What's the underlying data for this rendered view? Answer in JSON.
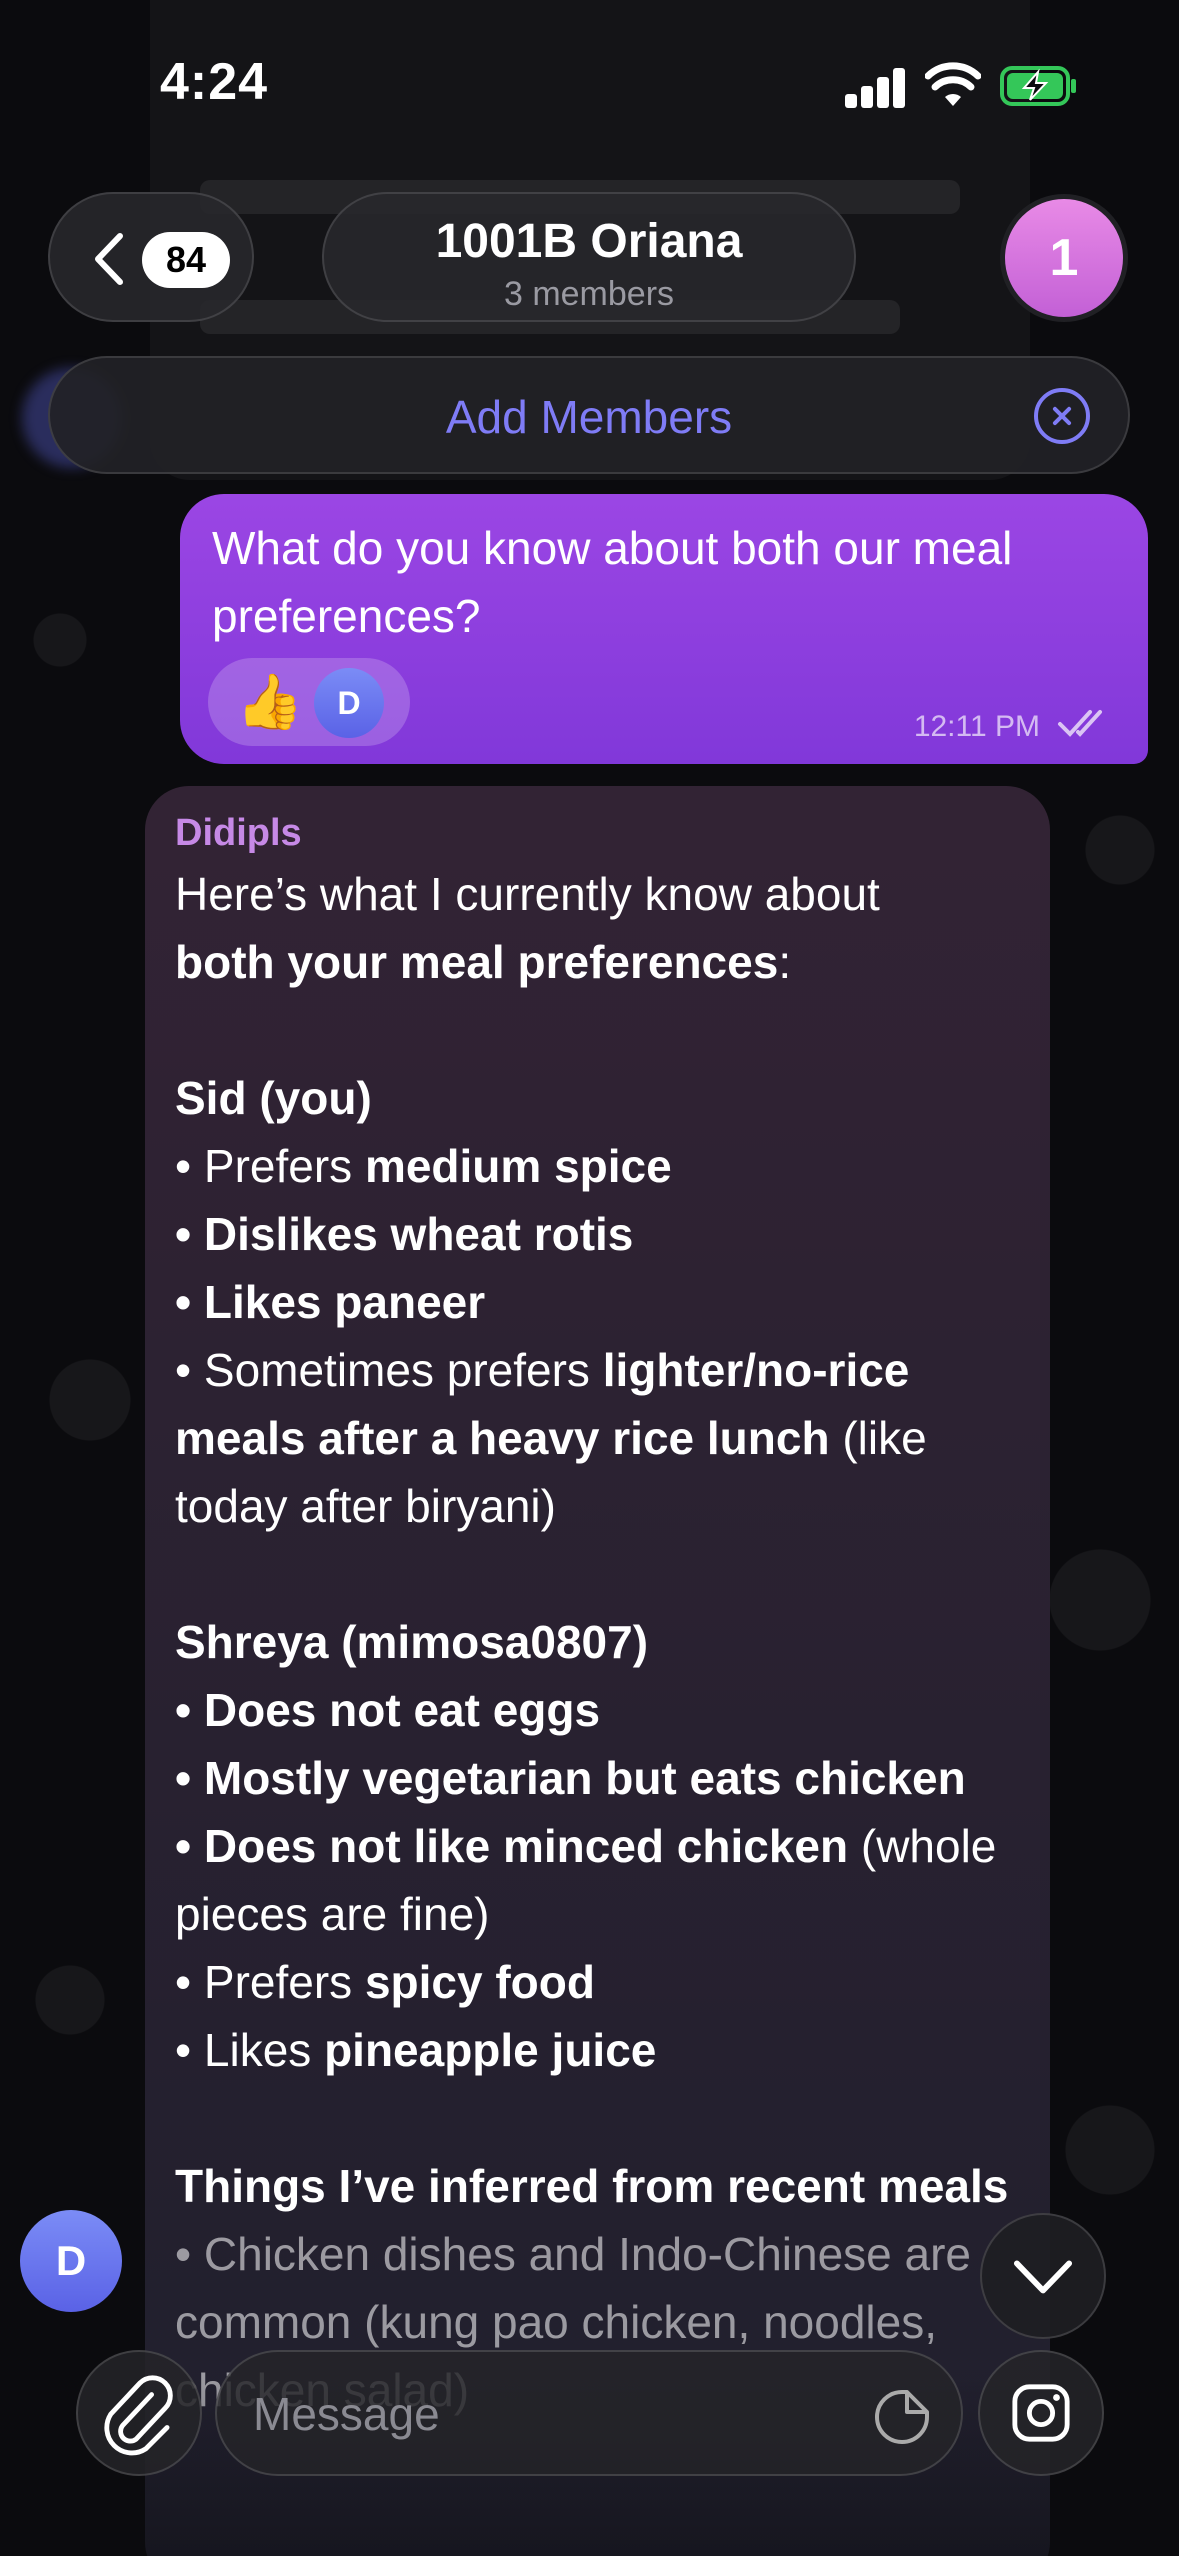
{
  "status_bar": {
    "time": "4:24"
  },
  "header": {
    "back_count": "84",
    "title": "1001B Oriana",
    "subtitle": "3 members",
    "avatar_initial": "1",
    "add_members_label": "Add Members"
  },
  "outgoing": {
    "text": "What do you know about both our meal preferences?",
    "reaction_emoji": "👍",
    "reaction_avatar_initial": "D",
    "time": "12:11 PM"
  },
  "incoming": {
    "sender": "Didipls",
    "intro": "Here’s what I currently know about",
    "intro_bold": "both your meal preferences",
    "intro_end": ":",
    "sid_heading": "Sid (you)",
    "sid_1_pre": "• Prefers ",
    "sid_1_bold": "medium spice",
    "sid_2": "• Dislikes wheat rotis",
    "sid_3": "• Likes paneer",
    "sid_4_pre": "• Sometimes prefers ",
    "sid_4_bold": "lighter/no-rice meals after a heavy rice lunch",
    "sid_4_post": " (like today after biryani)",
    "shreya_heading": "Shreya (mimosa0807)",
    "shreya_1": "• Does not eat eggs",
    "shreya_2": "• Mostly vegetarian but eats chicken",
    "shreya_3_bold": "• Does not like minced chicken",
    "shreya_3_post": " (whole pieces are fine)",
    "shreya_4_pre": "• Prefers ",
    "shreya_4_bold": "spicy food",
    "shreya_5_pre": "• Likes ",
    "shreya_5_bold": "pineapple juice",
    "inferred_heading": "Things I’ve inferred from recent meals",
    "inferred_1": "• Chicken dishes and Indo-Chinese are common (kung pao chicken, noodles, chicken salad)"
  },
  "composer": {
    "placeholder": "Message",
    "sender_avatar_initial": "D"
  },
  "colors": {
    "outgoing_bubble": "#8f40e0",
    "accent": "#7f7cf6",
    "sender_name": "#c689e6"
  }
}
